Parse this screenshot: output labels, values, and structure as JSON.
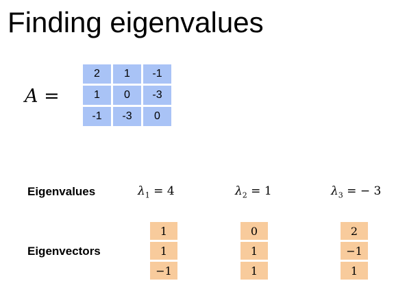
{
  "slide": {
    "title": "Finding eigenvalues"
  },
  "matrix": {
    "name": "A",
    "equals": "=",
    "rows": [
      [
        "2",
        "1",
        "-1"
      ],
      [
        "1",
        "0",
        "-3"
      ],
      [
        "-1",
        "-3",
        "0"
      ]
    ],
    "cell_color": "#a9c3f6"
  },
  "eigenvalues": {
    "label": "Eigenvalues",
    "items": [
      {
        "symbol": "λ",
        "subscript": "1",
        "rhs": " = 4"
      },
      {
        "symbol": "λ",
        "subscript": "2",
        "rhs": " = 1"
      },
      {
        "symbol": "λ",
        "subscript": "3",
        "rhs": " = − 3"
      }
    ]
  },
  "eigenvectors": {
    "label": "Eigenvectors",
    "cell_color": "#f8cb9c",
    "vectors": [
      [
        "1",
        "1",
        "−1"
      ],
      [
        "0",
        "1",
        "1"
      ],
      [
        "2",
        "−1",
        "1"
      ]
    ]
  }
}
